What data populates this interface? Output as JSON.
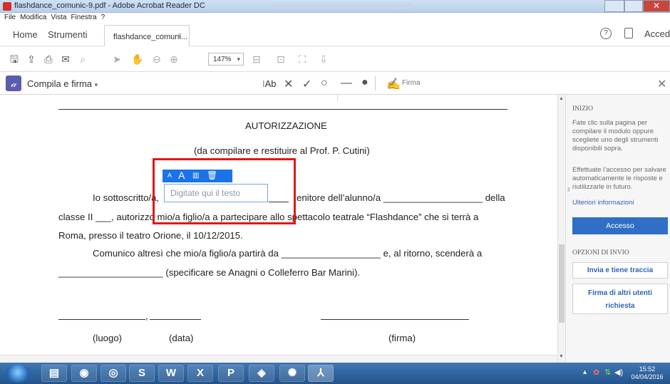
{
  "window": {
    "title": "flashdance_comunic-9.pdf - Adobe Acrobat Reader DC"
  },
  "menu": [
    "File",
    "Modifica",
    "Vista",
    "Finestra",
    "?"
  ],
  "nav": {
    "home": "Home",
    "tools": "Strumenti",
    "tab_label": "flashdance_comuni...",
    "tab_close": "×",
    "help": "?",
    "sign_in": "Accedi"
  },
  "toolbar": {
    "zoom": "147%"
  },
  "fill_sign": {
    "label": "Compila e firma",
    "text_tool": "Ab",
    "sign_label": "Firma"
  },
  "document": {
    "heading": "AUTORIZZAZIONE",
    "subheading": "(da compilare e restituire al Prof. P. Cutini)",
    "line1_a": "Io sottoscritto/a,",
    "line1_b": "enitore dell’alunno/a ___________________ della",
    "line2": "classe II ___, autorizzo mio/a figlio/a a partecipare allo spettacolo teatrale “Flashdance” che si terrà a",
    "line3": "Roma, presso il teatro Orione, il 10/12/2015.",
    "line4": "Comunico altresì che mio/a figlio/a partirà da ___________________ e, al ritorno, scenderà a",
    "line5": "____________________ (specificare se Anagni o Colleferro Bar Marini).",
    "sig_comma": ",",
    "label_place": "(luogo)",
    "label_date": "(data)",
    "label_sign": "(firma)"
  },
  "field_toolbar": {
    "small_a": "A",
    "large_a": "A"
  },
  "text_field": {
    "placeholder": "Digitate qui il testo"
  },
  "panel": {
    "start_heading": "INIZIO",
    "start_text": "Fate clic sulla pagina per compilare il modulo oppure scegliete uno degli strumenti disponibili sopra.",
    "access_text": "Effettuate l’accesso per salvare automaticamente le risposte e riutilizzarle in futuro.",
    "more_info": "Ulteriori informazioni",
    "access_button": "Accesso",
    "send_heading": "OPZIONI DI INVIO",
    "send_track": "Invia e tiene traccia",
    "sign_others": "Firma di altri utenti richiesta"
  },
  "taskbar": {
    "time": "15:52",
    "date": "04/04/2016"
  }
}
